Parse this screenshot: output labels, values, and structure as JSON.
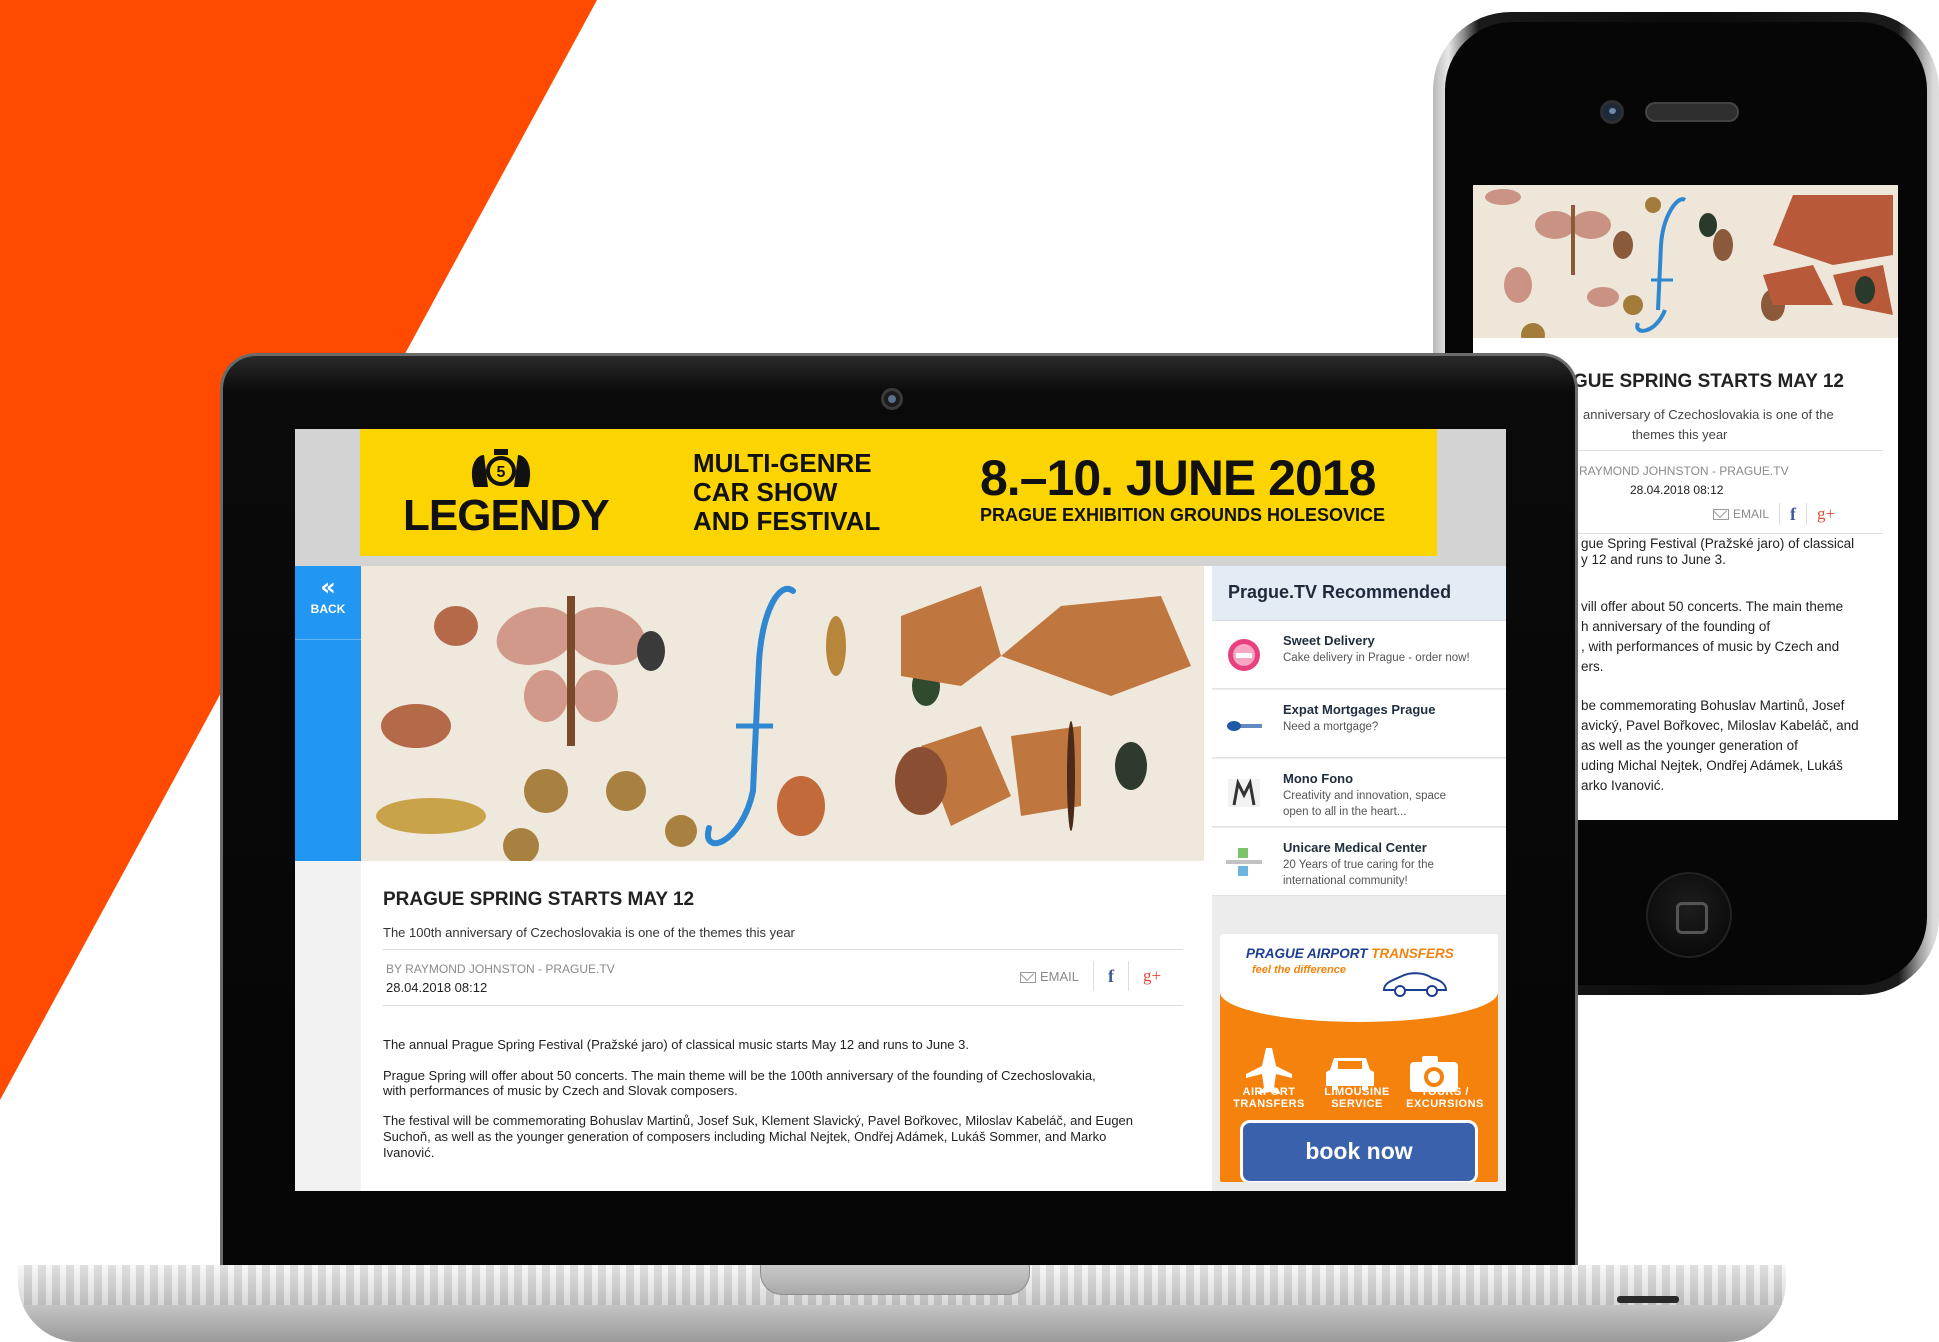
{
  "colors": {
    "brand_orange": "#ff4a00",
    "ad_yellow": "#fcd500",
    "back_blue": "#2196f3",
    "promo_orange": "#f5820d",
    "promo_blue": "#3a62ac"
  },
  "ad": {
    "logo": "LEGENDY",
    "tagline": [
      "MULTI-GENRE",
      "CAR SHOW",
      "AND FESTIVAL"
    ],
    "dates": "8.–10. JUNE 2018",
    "place": "PRAGUE EXHIBITION GROUNDS HOLESOVICE"
  },
  "nav": {
    "back_icon": "double-chevron-left-icon",
    "back_label": "BACK"
  },
  "article": {
    "title": "PRAGUE SPRING STARTS MAY 12",
    "subtitle": "The 100th anniversary of Czechoslovakia is one of the themes this year",
    "byline": "BY RAYMOND JOHNSTON - PRAGUE.TV",
    "date": "28.04.2018 08:12",
    "share": {
      "email_label": "EMAIL",
      "facebook": "f",
      "google_plus": "g+"
    },
    "paragraphs": [
      [
        "The annual Prague Spring Festival (Pražské jaro) of classical music starts May 12 and runs to June 3."
      ],
      [
        "Prague Spring will offer about 50 concerts. The main theme will be the 100th anniversary of the founding of Czechoslovakia,",
        "with performances of music by Czech and Slovak composers."
      ],
      [
        "The festival will be commemorating Bohuslav Martinů, Josef Suk, Klement Slavický, Pavel Bořkovec, Miloslav Kabeláč, and Eugen",
        "Suchoň, as well as the younger generation of composers including Michal Nejtek, Ondřej Adámek, Lukáš Sommer, and Marko",
        "Ivanović."
      ]
    ]
  },
  "sidebar": {
    "heading": "Prague.TV Recommended",
    "items": [
      {
        "name": "Sweet Delivery",
        "desc": [
          "Cake delivery in Prague - order now!"
        ],
        "icon": "sweet-delivery-logo-icon"
      },
      {
        "name": "Expat Mortgages Prague",
        "desc": [
          "Need a mortgage?"
        ],
        "icon": "mortgage-logo-icon"
      },
      {
        "name": "Mono Fono",
        "desc": [
          "Creativity and innovation, space",
          "open to all in the heart..."
        ],
        "icon": "mono-fono-logo-icon"
      },
      {
        "name": "Unicare Medical Center",
        "desc": [
          "20 Years of true caring for the",
          "international community!"
        ],
        "icon": "unicare-logo-icon"
      }
    ],
    "promo": {
      "title_a": "PRAGUE AIRPORT",
      "title_b": "TRANSFERS",
      "tagline": "feel the difference",
      "services": [
        {
          "label": [
            "AIRPORT",
            "TRANSFERS"
          ],
          "icon": "airplane-icon"
        },
        {
          "label": [
            "LIMOUSINE",
            "SERVICE"
          ],
          "icon": "car-icon"
        },
        {
          "label": [
            "TOURS /",
            "EXCURSIONS"
          ],
          "icon": "camera-icon"
        }
      ],
      "button": "book now"
    }
  },
  "phone": {
    "title": "GUE SPRING STARTS MAY 12",
    "subtitle": [
      "anniversary of Czechoslovakia is one of the",
      "themes this year"
    ],
    "byline": "RAYMOND JOHNSTON - PRAGUE.TV",
    "date": "28.04.2018 08:12",
    "email_label": "EMAIL",
    "body": [
      "gue Spring Festival (Pražské jaro) of classical",
      "y 12 and runs to June 3.",
      "",
      "vill offer about 50 concerts. The main theme",
      "h anniversary of the founding of",
      ", with performances of music by Czech and",
      "ers.",
      "",
      "be commemorating Bohuslav Martinů, Josef",
      "avický, Pavel Bořkovec, Miloslav Kabeláč, and",
      "as well as the younger generation of",
      "uding Michal Nejtek, Ondřej Adámek, Lukáš",
      "arko Ivanović."
    ]
  }
}
